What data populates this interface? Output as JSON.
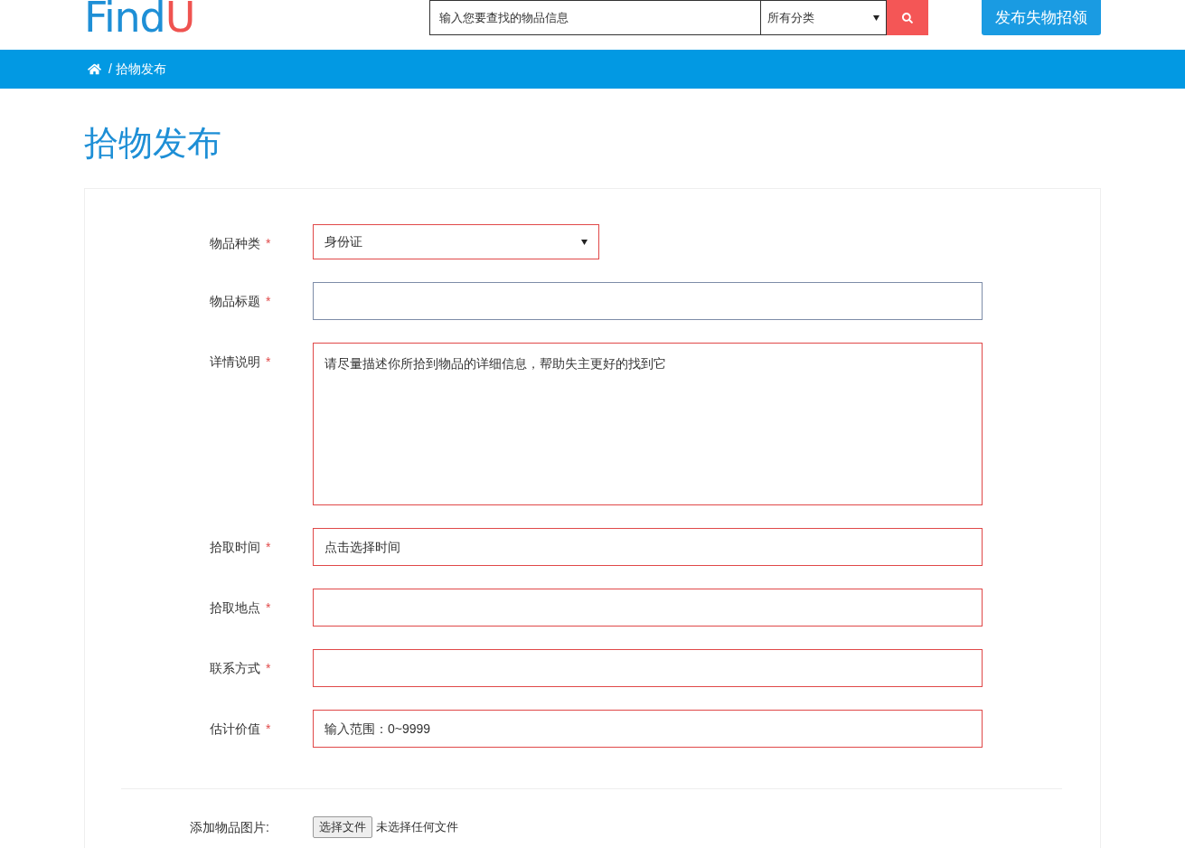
{
  "header": {
    "logo": {
      "main": "Find",
      "accent": "U"
    },
    "search": {
      "placeholder": "输入您要查找的物品信息",
      "category": "所有分类"
    },
    "publish_button": "发布失物招领"
  },
  "breadcrumb": {
    "separator": "/",
    "current": "拾物发布"
  },
  "page_title": "拾物发布",
  "form": {
    "required_mark": "*",
    "fields": [
      {
        "kind": "select",
        "label": "物品种类",
        "value": "身份证",
        "invalid": true
      },
      {
        "kind": "input",
        "label": "物品标题",
        "invalid": false
      },
      {
        "kind": "textarea",
        "label": "详情说明",
        "placeholder": "请尽量描述你所拾到物品的详细信息，帮助失主更好的找到它",
        "invalid": true
      },
      {
        "kind": "input",
        "label": "拾取时间",
        "placeholder": "点击选择时间",
        "invalid": true
      },
      {
        "kind": "input",
        "label": "拾取地点",
        "invalid": true
      },
      {
        "kind": "input",
        "label": "联系方式",
        "invalid": true
      },
      {
        "kind": "input",
        "label": "估计价值",
        "placeholder": "输入范围：0~9999",
        "invalid": true
      }
    ],
    "upload": {
      "label": "添加物品图片:",
      "button": "选择文件",
      "status": "未选择任何文件"
    }
  }
}
